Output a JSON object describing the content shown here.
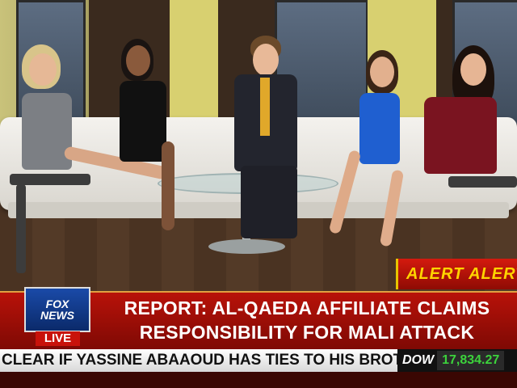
{
  "broadcast": {
    "alert_label": "ALERT ALERT",
    "headline_line1": "REPORT: AL-QAEDA AFFILIATE CLAIMS",
    "headline_line2": "RESPONSIBILITY FOR MALI ATTACK",
    "network_logo_line1": "FOX",
    "network_logo_line2": "NEWS",
    "live_label": "LIVE",
    "ticker_text": "CLEAR IF YASSINE ABAAOUD HAS TIES TO HIS BROTHER'S EURO",
    "market_label": "DOW",
    "market_value": "17,834.27"
  },
  "colors": {
    "banner_red": "#b81209",
    "alert_yellow": "#ffd400",
    "market_green": "#3cd23c",
    "logo_blue": "#1a4aa8"
  }
}
